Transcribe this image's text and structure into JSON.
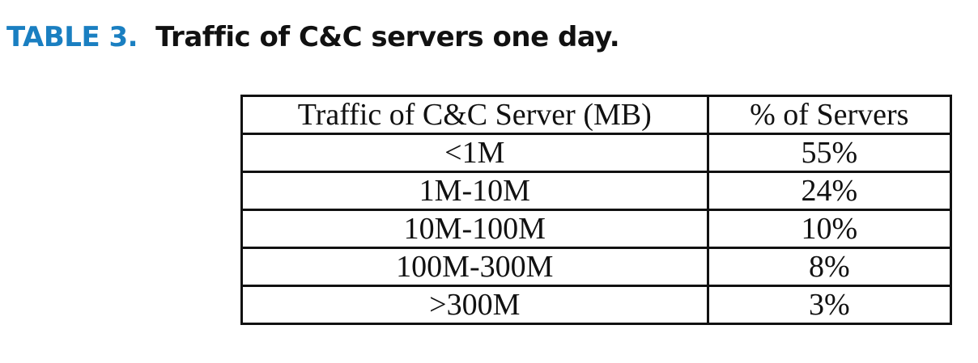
{
  "caption": {
    "label": "TABLE 3.",
    "title": "Traffic of C&C servers one day."
  },
  "table": {
    "headers": [
      "Traffic of C&C Server (MB)",
      "% of Servers"
    ],
    "rows": [
      [
        "<1M",
        "55%"
      ],
      [
        "1M-10M",
        "24%"
      ],
      [
        "10M-100M",
        "10%"
      ],
      [
        "100M-300M",
        "8%"
      ],
      [
        ">300M",
        "3%"
      ]
    ]
  },
  "colors": {
    "caption_label": "#1a7fc1",
    "text": "#111111",
    "border": "#111111"
  }
}
